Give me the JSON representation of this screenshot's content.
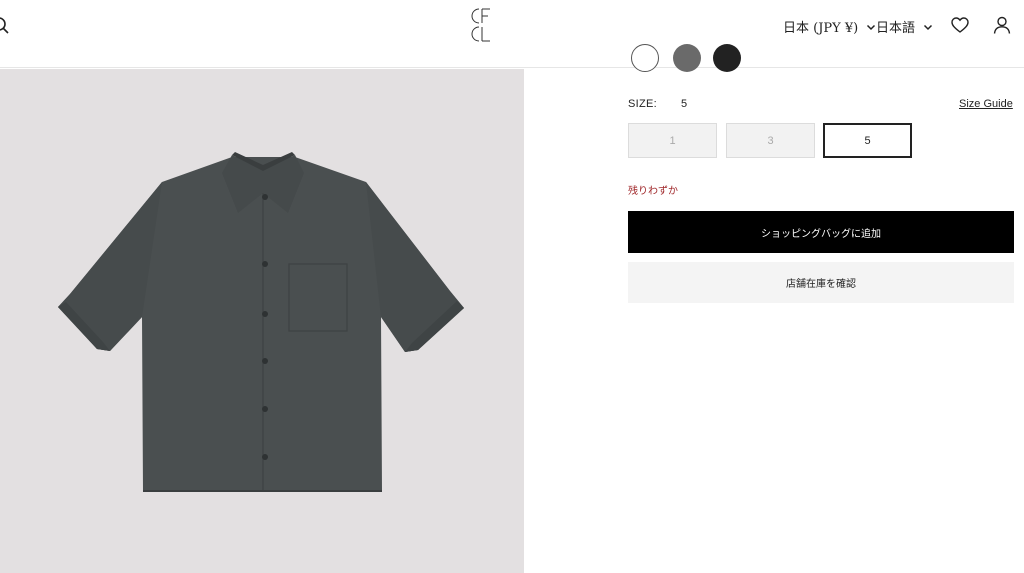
{
  "header": {
    "currency_label": "日本 (JPY ¥)",
    "language_label": "日本語",
    "icons": [
      "search-icon",
      "logo",
      "chevron-down-icon",
      "heart-icon",
      "user-icon"
    ]
  },
  "product": {
    "color_swatches": [
      "#ffffff",
      "#6a6a6a",
      "#222222"
    ],
    "image_background": "#e3e0e1",
    "shirt_color": "#4a4f50"
  },
  "size": {
    "label": "SIZE:",
    "selected_value": "5",
    "guide_label": "Size Guide",
    "options": [
      {
        "label": "1",
        "state": "disabled"
      },
      {
        "label": "3",
        "state": "disabled"
      },
      {
        "label": "5",
        "state": "selected"
      }
    ]
  },
  "stock_warning": "残りわずか",
  "actions": {
    "add_to_bag": "ショッピングバッグに追加",
    "check_store_stock": "店舗在庫を確認"
  },
  "colors": {
    "warning": "#a0282b",
    "primary_button": "#000000",
    "secondary_button": "#f4f4f4"
  }
}
